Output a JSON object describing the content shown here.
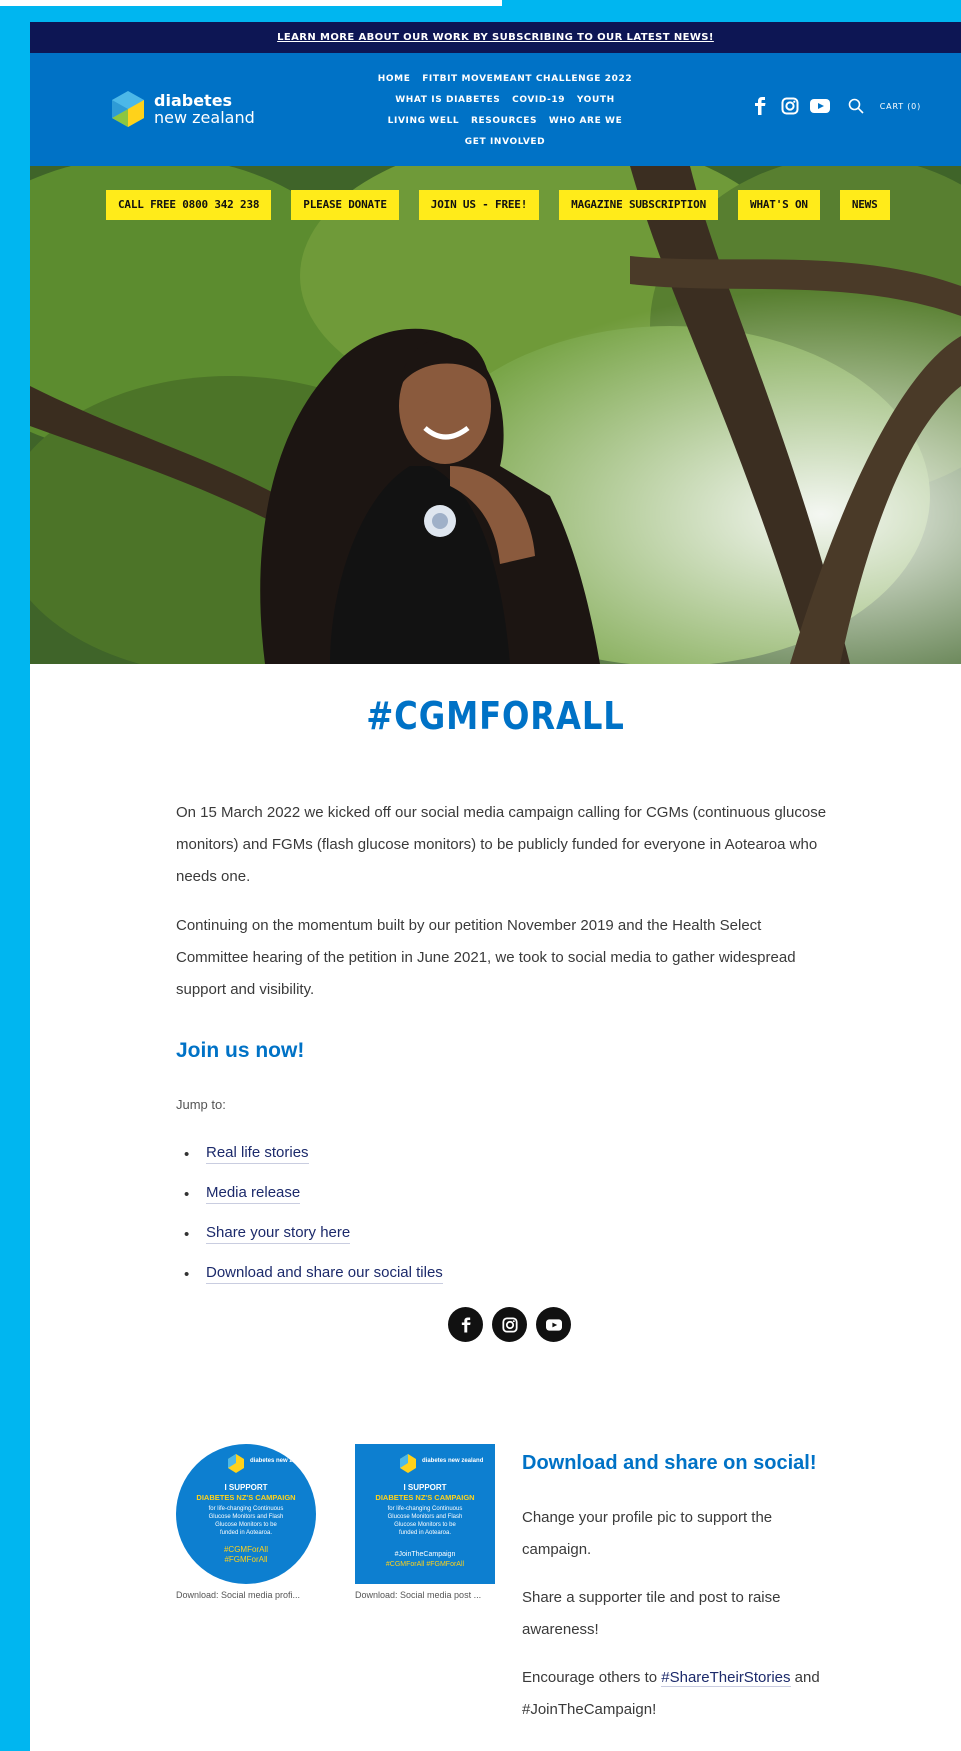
{
  "announcement": "LEARN MORE ABOUT OUR WORK BY SUBSCRIBING TO OUR LATEST NEWS!",
  "logo": {
    "line1": "diabetes",
    "line2": "new zealand"
  },
  "nav": {
    "row1": [
      "HOME",
      "FITBIT MOVEMEANT CHALLENGE 2022"
    ],
    "row2": [
      "WHAT IS DIABETES",
      "COVID-19",
      "YOUTH"
    ],
    "row3": [
      "LIVING WELL",
      "RESOURCES",
      "WHO ARE WE"
    ],
    "row4": [
      "GET INVOLVED"
    ]
  },
  "header_right": {
    "cart": "CART (0)",
    "icons": [
      "facebook-icon",
      "instagram-icon",
      "youtube-icon",
      "search-icon"
    ]
  },
  "cta": [
    "CALL FREE 0800 342 238",
    "PLEASE DONATE",
    "JOIN US - FREE!",
    "MAGAZINE SUBSCRIPTION",
    "WHAT'S ON",
    "NEWS"
  ],
  "page_title": "#CGMFORALL",
  "intro": {
    "p1": "On 15 March 2022 we kicked off our social media campaign calling for CGMs (continuous glucose monitors) and FGMs (flash glucose monitors) to be publicly funded for everyone in Aotearoa who needs one.",
    "p2": "Continuing on the momentum built by our petition November 2019 and the Health Select Committee hearing of the petition in June 2021, we took to social media to gather widespread support and visibility."
  },
  "join_heading": "Join us now!",
  "jump_label": "Jump to:",
  "jump_links": [
    "Real life stories",
    "Media release",
    "Share your story here",
    "Download and share our social tiles"
  ],
  "tiles": [
    {
      "caption": "Download: Social media profi...",
      "logo": "diabetes new zealand",
      "support": "I SUPPORT",
      "campaign": "DIABETES NZ'S CAMPAIGN",
      "body": [
        "for life-changing Continuous",
        "Glucose Monitors and Flash",
        "Glucose Monitors to be",
        "funded in Aotearoa."
      ],
      "tags": [
        "#CGMForAll",
        "#FGMForAll"
      ]
    },
    {
      "caption": "Download: Social media post ...",
      "logo": "diabetes new zealand",
      "support": "I SUPPORT",
      "campaign": "DIABETES NZ'S CAMPAIGN",
      "body": [
        "for life-changing Continuous",
        "Glucose Monitors and Flash",
        "Glucose Monitors to be",
        "funded in Aotearoa."
      ],
      "tags": [
        "#JoinTheCampaign",
        "#CGMForAll  #FGMForAll"
      ]
    }
  ],
  "download_section": {
    "heading": "Download and share on social!",
    "p1": "Change your profile pic to support the campaign.",
    "p2": "Share a supporter tile and post to raise awareness!",
    "p3_before": "Encourage others to ",
    "p3_link": "#ShareTheirStories",
    "p3_after": " and #JoinTheCampaign!"
  },
  "colors": {
    "brand_blue": "#0072c6",
    "navy": "#0d1654",
    "frame": "#00b6f0",
    "cta_yellow": "#ffeb1a"
  }
}
